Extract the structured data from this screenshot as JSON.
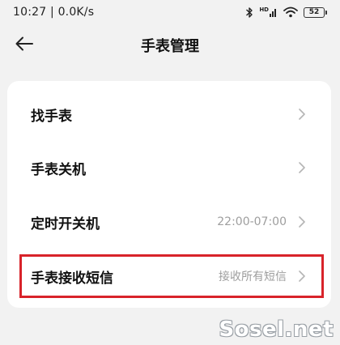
{
  "status_bar": {
    "time_speed": "10:27 | 0.0K/s",
    "network_tag": "HD",
    "battery_level": "52",
    "icons": [
      "bluetooth-icon",
      "hd-signal-icon",
      "wifi-icon",
      "battery-icon"
    ]
  },
  "header": {
    "back_icon": "arrow-left-icon",
    "title": "手表管理"
  },
  "settings": {
    "items": [
      {
        "label": "找手表",
        "value": ""
      },
      {
        "label": "手表关机",
        "value": ""
      },
      {
        "label": "定时开关机",
        "value": "22:00-07:00"
      },
      {
        "label": "手表接收短信",
        "value": "接收所有短信"
      }
    ]
  },
  "colors": {
    "background": "#f2f2f2",
    "card": "#ffffff",
    "highlight": "#d8232a",
    "secondary_text": "#9e9e9e"
  },
  "watermark": "Sosel.net"
}
